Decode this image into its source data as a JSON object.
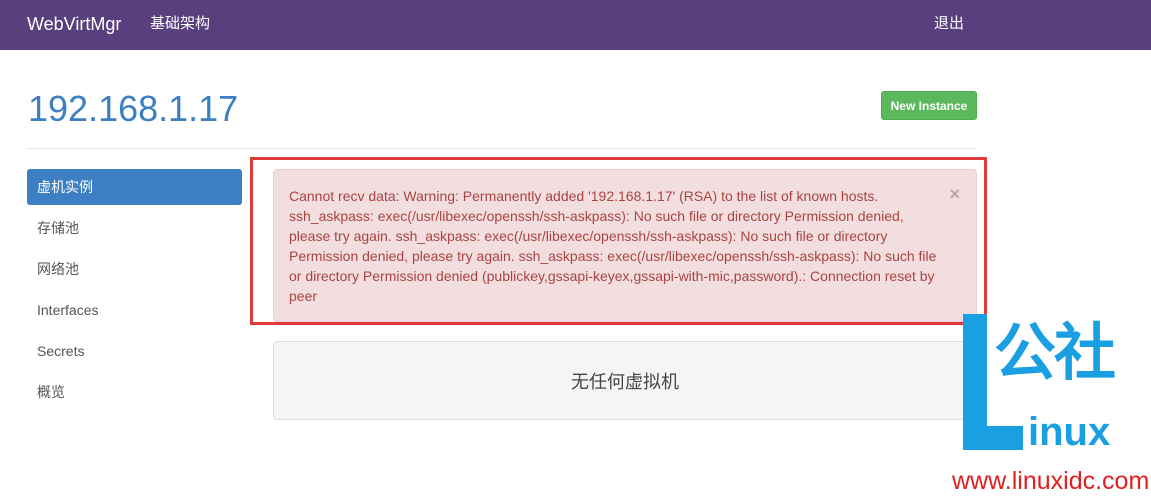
{
  "navbar": {
    "brand": "WebVirtMgr",
    "infrastructure": "基础架构",
    "logout": "退出"
  },
  "header": {
    "host": "192.168.1.17",
    "new_instance": "New Instance"
  },
  "sidebar": {
    "items": [
      {
        "label": "虚机实例"
      },
      {
        "label": "存储池"
      },
      {
        "label": "网络池"
      },
      {
        "label": "Interfaces"
      },
      {
        "label": "Secrets"
      },
      {
        "label": "概览"
      }
    ]
  },
  "alert": {
    "message": "Cannot recv data: Warning: Permanently added '192.168.1.17' (RSA) to the list of known hosts. ssh_askpass: exec(/usr/libexec/openssh/ssh-askpass): No such file or directory Permission denied, please try again. ssh_askpass: exec(/usr/libexec/openssh/ssh-askpass): No such file or directory Permission denied, please try again. ssh_askpass: exec(/usr/libexec/openssh/ssh-askpass): No such file or directory Permission denied (publickey,gssapi-keyex,gssapi-with-mic,password).: Connection reset by peer",
    "close": "×"
  },
  "main": {
    "empty_text": "无任何虚拟机"
  },
  "watermark": {
    "big_text": "公社",
    "inux_text": "inux",
    "url": "www.linuxidc.com"
  }
}
